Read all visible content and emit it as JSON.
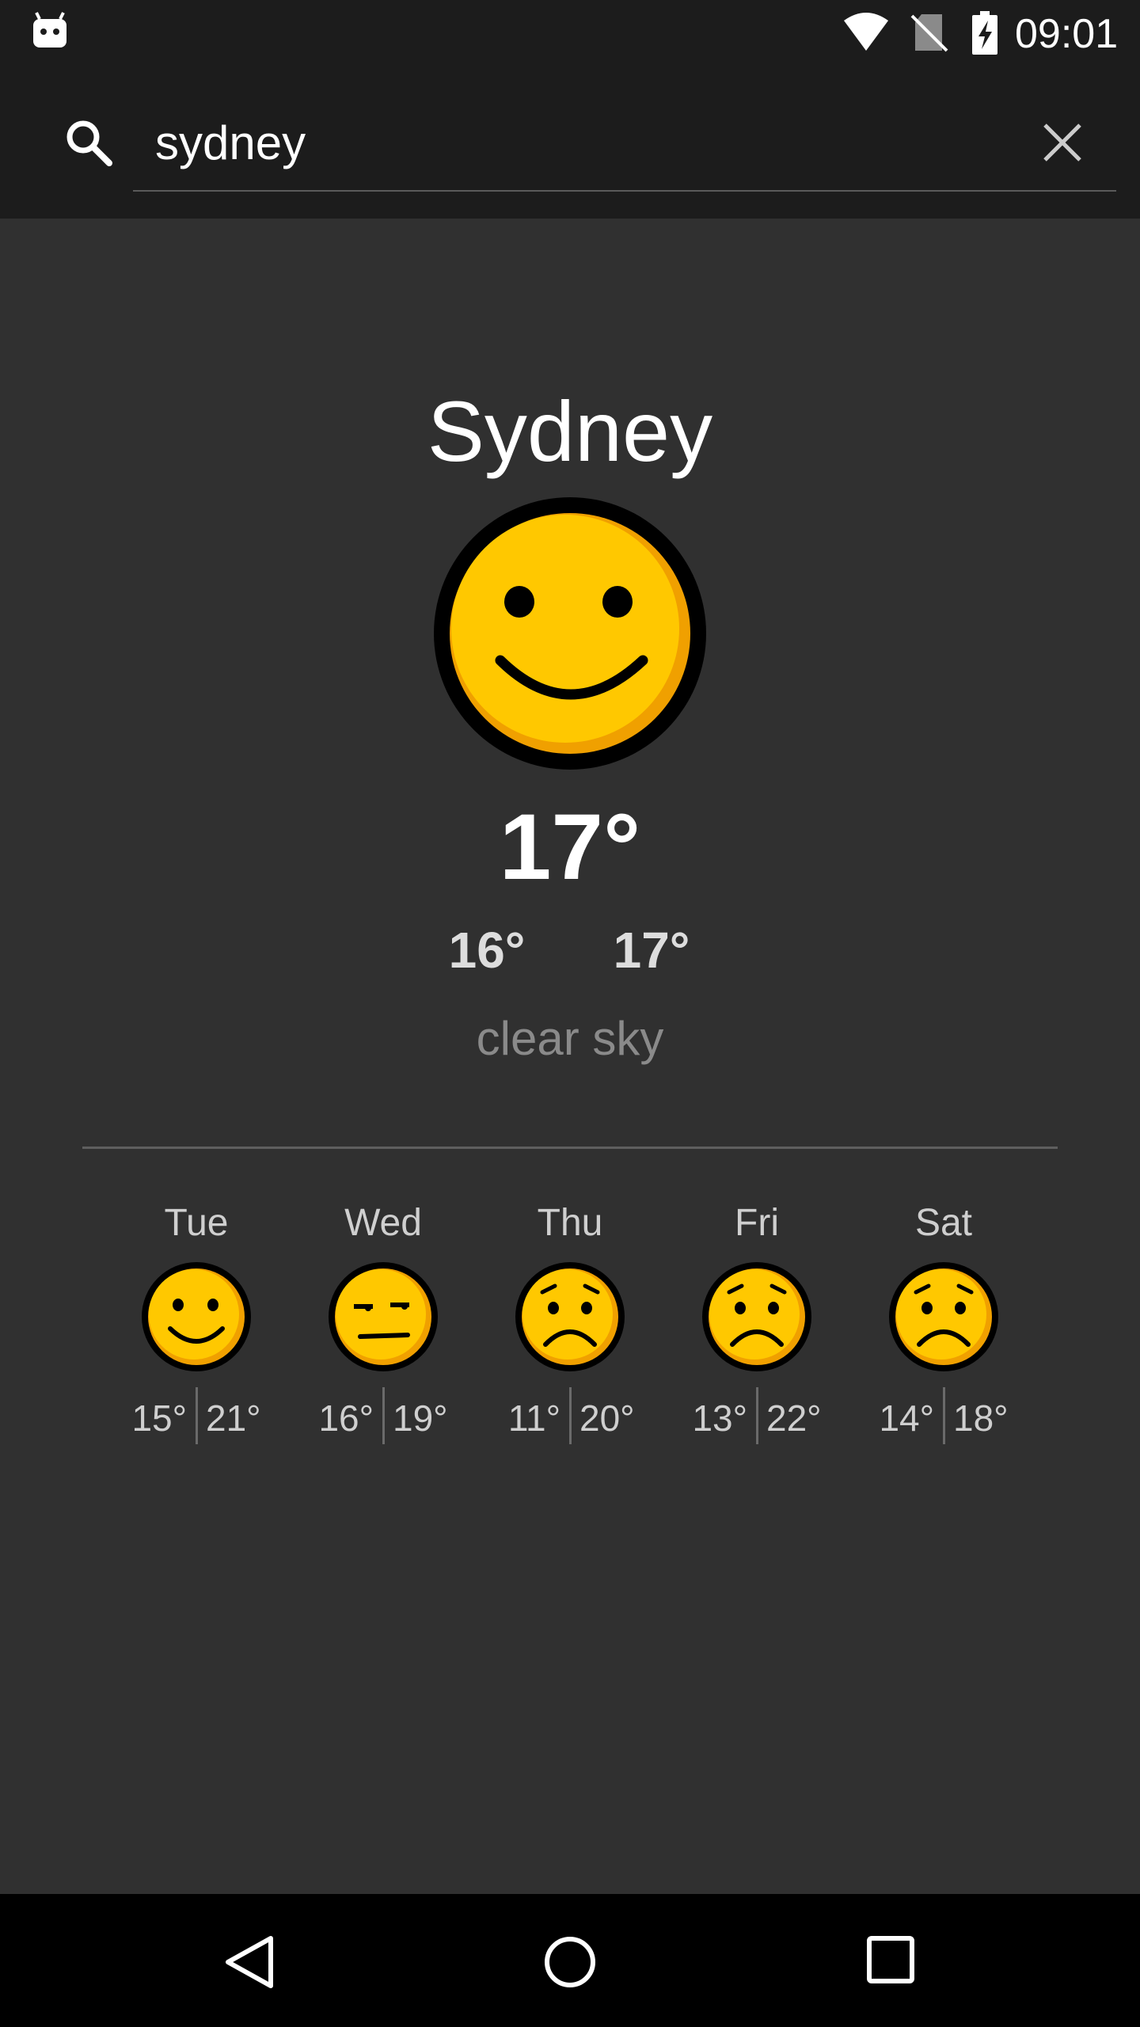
{
  "status_bar": {
    "time": "09:01",
    "icons": [
      "android-app-icon",
      "wifi-icon",
      "no-sim-icon",
      "battery-charging-icon"
    ]
  },
  "search": {
    "value": "sydney",
    "icons": [
      "search-icon",
      "close-icon"
    ]
  },
  "current": {
    "city": "Sydney",
    "condition_icon": "happy-face-icon",
    "temperature": "17°",
    "min": "16°",
    "max": "17°",
    "description": "clear sky"
  },
  "forecast": [
    {
      "day": "Tue",
      "icon": "happy-face-icon",
      "min": "15°",
      "max": "21°"
    },
    {
      "day": "Wed",
      "icon": "unamused-face-icon",
      "min": "16°",
      "max": "19°"
    },
    {
      "day": "Thu",
      "icon": "sad-face-icon",
      "min": "11°",
      "max": "20°"
    },
    {
      "day": "Fri",
      "icon": "sad-face-icon",
      "min": "13°",
      "max": "22°"
    },
    {
      "day": "Sat",
      "icon": "sad-face-icon",
      "min": "14°",
      "max": "18°"
    }
  ],
  "nav_bar": {
    "icons": [
      "back-icon",
      "home-icon",
      "recents-icon"
    ]
  },
  "colors": {
    "background": "#303030",
    "bar": "#1c1c1c",
    "face_yellow": "#ffc800",
    "face_shadow": "#f0a000"
  }
}
